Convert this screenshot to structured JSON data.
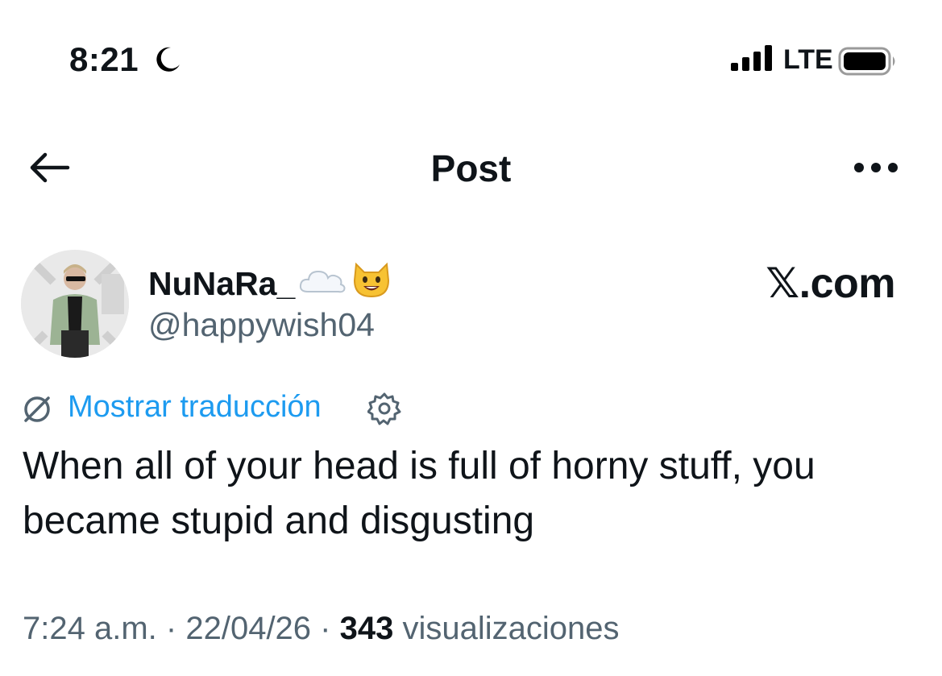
{
  "status_bar": {
    "time": "8:21",
    "network": "LTE",
    "icons": [
      "moon-icon",
      "signal-icon",
      "battery-icon"
    ]
  },
  "header": {
    "title": "Post",
    "icons": [
      "back-arrow-icon",
      "more-options-icon"
    ]
  },
  "author": {
    "display_name": "NuNaRa_",
    "name_emojis": [
      "cloud-icon",
      "cat-face-icon"
    ],
    "handle": "@happywish04",
    "avatar": "avatar-photo"
  },
  "watermark": "𝕏.com",
  "translate": {
    "label": "Mostrar traducción",
    "icons": [
      "translate-icon",
      "settings-gear-icon"
    ]
  },
  "tweet": {
    "text": "When all of your head is full of horny stuff, you became stupid and disgusting"
  },
  "meta": {
    "time": "7:24 a.m.",
    "separator": "·",
    "date": "22/04/26",
    "views_count": "343",
    "views_label": "visualizaciones"
  },
  "colors": {
    "text": "#0f1419",
    "secondary": "#536471",
    "link": "#1d9bf0"
  }
}
